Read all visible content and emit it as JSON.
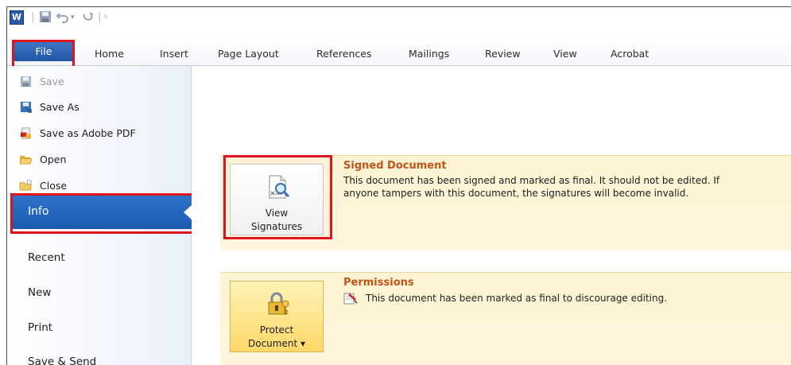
{
  "app": {
    "logo_letter": "W"
  },
  "quick_access": {
    "save_icon": "save-icon",
    "undo_icon": "undo-icon",
    "redo_icon": "redo-icon",
    "customize_icon": "customize-qat-icon"
  },
  "ribbon": {
    "file_tab": "File",
    "tabs": [
      "Home",
      "Insert",
      "Page Layout",
      "References",
      "Mailings",
      "Review",
      "View",
      "Acrobat"
    ]
  },
  "backstage": {
    "commands": [
      {
        "label": "Save",
        "icon": "save-icon",
        "enabled": false
      },
      {
        "label": "Save As",
        "icon": "save-as-icon",
        "enabled": true
      },
      {
        "label": "Save as Adobe PDF",
        "icon": "adobe-pdf-icon",
        "enabled": true
      },
      {
        "label": "Open",
        "icon": "open-folder-icon",
        "enabled": true
      },
      {
        "label": "Close",
        "icon": "close-folder-icon",
        "enabled": true
      }
    ],
    "nav": {
      "selected": "Info",
      "items": [
        "Recent",
        "New",
        "Print",
        "Save & Send"
      ]
    }
  },
  "info": {
    "signed": {
      "button_line1": "View",
      "button_line2": "Signatures",
      "title": "Signed Document",
      "line1": "This document has been signed and marked as final. It should not be edited.  If",
      "line2": "anyone tampers with this document, the signatures will become invalid."
    },
    "permissions": {
      "button_line1": "Protect",
      "button_line2": "Document ▾",
      "title": "Permissions",
      "text": "This document has been marked as final to discourage editing."
    }
  },
  "colors": {
    "highlight_box": "#e0141e",
    "file_tab": "#2a62b4",
    "info_selected": "#2369c0",
    "section_title": "#c0571a",
    "section_bg": "#fdf4d6"
  }
}
